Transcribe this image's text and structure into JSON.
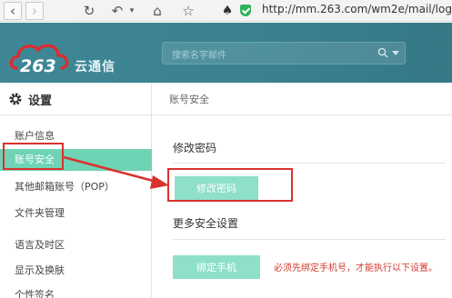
{
  "browser": {
    "url": "http://mm.263.com/wm2e/mail/login",
    "colors": {
      "secure": "#2fb25a"
    }
  },
  "header": {
    "logo_text": "云通信",
    "logo_mark": "263",
    "search_placeholder": "搜索名字邮件"
  },
  "sidebar": {
    "title": "设置",
    "items": [
      {
        "label": "账户信息",
        "active": false
      },
      {
        "label": "账号安全",
        "active": true
      },
      {
        "label": "其他邮箱账号（POP）",
        "active": false
      },
      {
        "label": "文件夹管理",
        "active": false
      },
      {
        "label": "语言及时区",
        "active": false
      },
      {
        "label": "显示及换肤",
        "active": false
      },
      {
        "label": "个性签名",
        "active": false
      }
    ]
  },
  "main": {
    "breadcrumb": "账号安全",
    "section1_title": "修改密码",
    "change_password_button": "修改密码",
    "section2_title": "更多安全设置",
    "bind_phone_button": "绑定手机",
    "bind_phone_note": "必须先绑定手机号，才能执行以下设置。"
  },
  "colors": {
    "header_bg": "#3f8796",
    "active_item": "#6fd3b6",
    "button": "#8ee0c8",
    "annotation": "#d9322e"
  }
}
